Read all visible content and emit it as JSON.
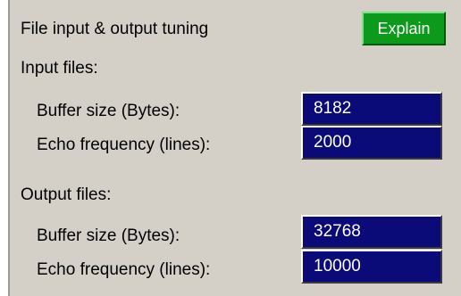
{
  "panel": {
    "title": "File input & output tuning",
    "explain_label": "Explain",
    "input_section": {
      "heading": "Input files:",
      "buffer_label": "Buffer size (Bytes):",
      "buffer_value": "8182",
      "echo_label": "Echo frequency (lines):",
      "echo_value": "2000"
    },
    "output_section": {
      "heading": "Output files:",
      "buffer_label": "Buffer size (Bytes):",
      "buffer_value": "32768",
      "echo_label": "Echo frequency (lines):",
      "echo_value": "10000"
    }
  },
  "colors": {
    "panel_bg": "#d4d0c8",
    "explain_button_bg": "#0c9a1a",
    "field_bg": "#0a0a78",
    "field_text": "#ffffff"
  }
}
